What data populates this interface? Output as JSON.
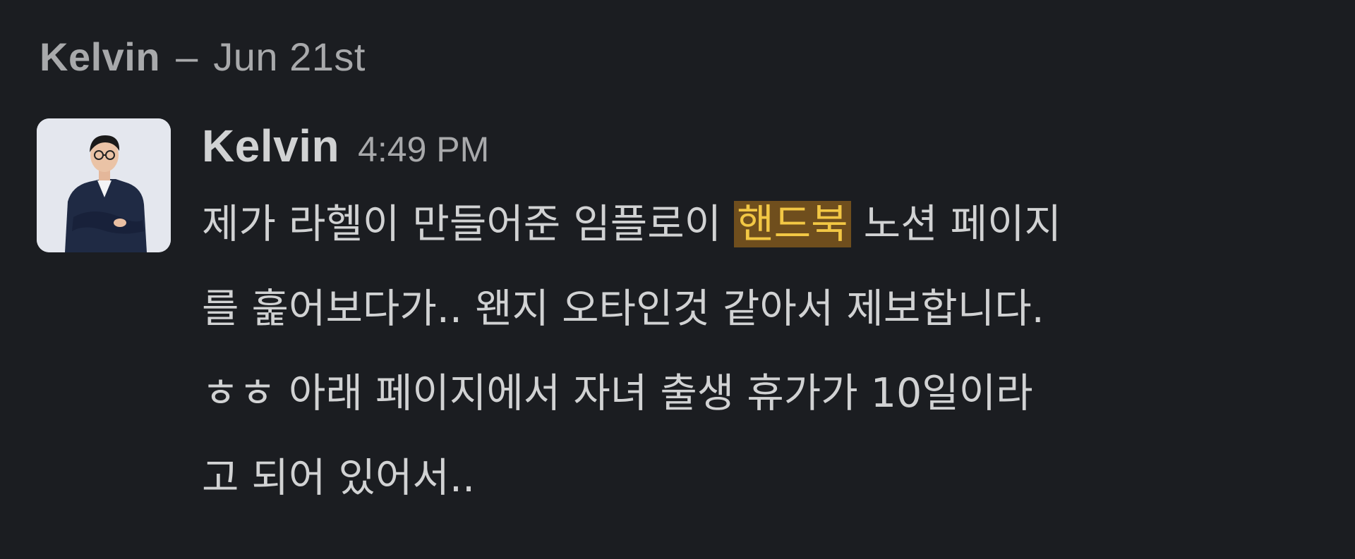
{
  "day_header": {
    "name": "Kelvin",
    "separator": "–",
    "date": "Jun 21st"
  },
  "message": {
    "author": "Kelvin",
    "time": "4:49 PM",
    "avatar_icon": "person-photo-avatar",
    "lines": [
      {
        "before": "제가 라헬이 만들어준 임플로이 ",
        "highlight": "핸드북",
        "after": " 노션 페이지"
      },
      {
        "text": "를 훑어보다가.. 왠지 오타인것 같아서 제보합니다."
      },
      {
        "text": "ㅎㅎ 아래 페이지에서 자녀 출생 휴가가 10일이라"
      },
      {
        "text": "고 되어 있어서.."
      }
    ],
    "highlight_color": "#f2c744",
    "highlight_bg": "#6f4e1d"
  }
}
